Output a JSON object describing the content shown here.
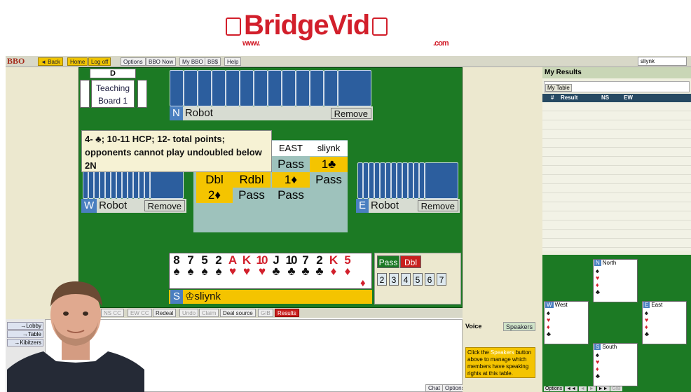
{
  "banner": {
    "brand": "BridgeVid",
    "www": "www.",
    "com": ".com"
  },
  "topbar": {
    "bbo_logo": "BBO",
    "buttons": [
      "◄ Back",
      "Home",
      "Log off",
      "Options",
      "BBO Now",
      "My BBO",
      "BB$",
      "Help"
    ],
    "username": "sliynk"
  },
  "table": {
    "dealer": "D",
    "teaching_line1": "Teaching",
    "teaching_line2": "Board 1",
    "north": {
      "seat": "N",
      "name": "Robot",
      "remove": "Remove"
    },
    "west": {
      "seat": "W",
      "name": "Robot",
      "remove": "Remove"
    },
    "east": {
      "seat": "E",
      "name": "Robot",
      "remove": "Remove"
    },
    "south": {
      "seat": "S",
      "name": "sliynk",
      "crown": "♔"
    }
  },
  "tooltip": "4- ♣; 10-11 HCP; 12- total points; opponents cannot play undoubled below 2N",
  "bidding": {
    "headers": [
      "EAST",
      "sliynk"
    ],
    "row1": [
      "Pass",
      "1♣"
    ],
    "row2": [
      "Dbl",
      "Rdbl",
      "1♦",
      "Pass"
    ],
    "row3": [
      "2♦",
      "Pass",
      "Pass"
    ]
  },
  "hand": {
    "cards": [
      {
        "rank": "8",
        "suit": "♠",
        "color": "black"
      },
      {
        "rank": "7",
        "suit": "♠",
        "color": "black"
      },
      {
        "rank": "5",
        "suit": "♠",
        "color": "black"
      },
      {
        "rank": "2",
        "suit": "♠",
        "color": "black"
      },
      {
        "rank": "A",
        "suit": "♥",
        "color": "red"
      },
      {
        "rank": "K",
        "suit": "♥",
        "color": "red"
      },
      {
        "rank": "10",
        "suit": "♥",
        "color": "red"
      },
      {
        "rank": "J",
        "suit": "♣",
        "color": "black"
      },
      {
        "rank": "10",
        "suit": "♣",
        "color": "black"
      },
      {
        "rank": "7",
        "suit": "♣",
        "color": "black"
      },
      {
        "rank": "2",
        "suit": "♣",
        "color": "black"
      },
      {
        "rank": "K",
        "suit": "♦",
        "color": "red"
      },
      {
        "rank": "5",
        "suit": "♦",
        "color": "red"
      }
    ],
    "corner_suit": "♦"
  },
  "bidbox": {
    "pass": "Pass",
    "dbl": "Dbl",
    "levels": [
      "2",
      "3",
      "4",
      "5",
      "6",
      "7"
    ]
  },
  "bottom_tabs": [
    "NS CC",
    "EW CC",
    "Redeal",
    "Undo",
    "Claim",
    "Deal source",
    "GIB",
    "Results"
  ],
  "side_tabs": [
    "→Lobby",
    "→Table",
    "→Kibitzers"
  ],
  "voice": {
    "label": "Voice",
    "speakers": "Speakers",
    "help_pre": "Click the ",
    "help_link": "Speakers",
    "help_post": " button above to manage which members have speaking rights at this table."
  },
  "chat_buttons": [
    "Chat",
    "Options"
  ],
  "results": {
    "title": "My Results",
    "tab": "My Table",
    "columns": [
      "#",
      "Result",
      "NS",
      "EW"
    ]
  },
  "mini_table": {
    "north": "North",
    "west": "West",
    "east": "East",
    "south": "South",
    "seats": [
      "N",
      "W",
      "E",
      "S"
    ],
    "suits": [
      "♠",
      "♥",
      "♦",
      "♣"
    ]
  },
  "mini_controls": [
    "Options",
    "◄◄",
    "◄",
    "►",
    "►►",
    "GIB"
  ],
  "colors": {
    "felt": "#1c7a24",
    "highlight": "#f4c400",
    "brand_red": "#d21f2b",
    "seat_blue": "#4a7fc0"
  }
}
